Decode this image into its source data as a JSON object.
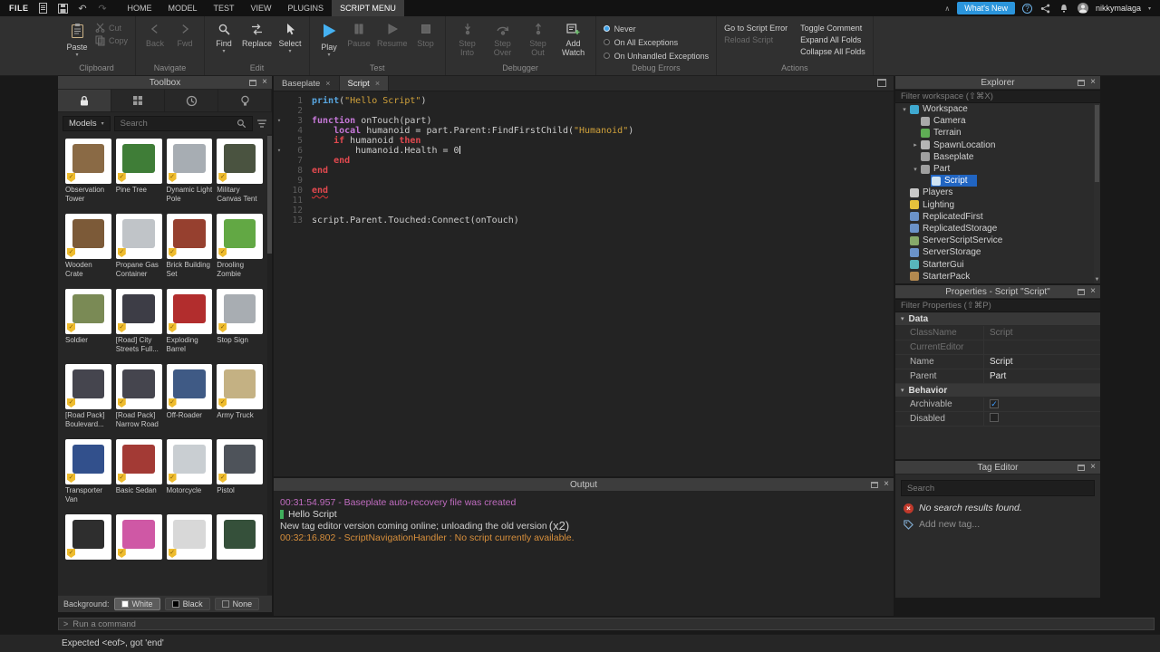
{
  "colors": {
    "selection": "#2165c2",
    "play_button": "#45b1f2",
    "whats_new_button": "#2b95dc",
    "code_keyword": "#c678d8",
    "code_keyword_alt": "#e2494f",
    "code_string": "#d1a23b",
    "code_builtin": "#58a6e0",
    "output_info": "#c06cc0",
    "output_warning": "#d78f3c",
    "output_success_bar": "#3fae5c",
    "verified_badge": "#eebc2e"
  },
  "titlebar": {
    "file_label": "FILE",
    "menu_tabs": [
      "HOME",
      "MODEL",
      "TEST",
      "VIEW",
      "PLUGINS",
      "SCRIPT MENU"
    ],
    "active_tab": "SCRIPT MENU",
    "whats_new": "What's New",
    "username": "nikkymalaga"
  },
  "ribbon": {
    "group_labels": [
      "Clipboard",
      "Navigate",
      "Edit",
      "Test",
      "Debugger",
      "Debug Errors",
      "Actions"
    ],
    "clipboard": {
      "paste": "Paste",
      "cut": "Cut",
      "copy": "Copy"
    },
    "navigate": {
      "back": "Back",
      "fwd": "Fwd"
    },
    "edit": {
      "find": "Find",
      "replace": "Replace",
      "select": "Select"
    },
    "test": {
      "play": "Play",
      "pause": "Pause",
      "resume": "Resume",
      "stop": "Stop"
    },
    "debugger": {
      "step_into": "Step Into",
      "step_over": "Step Over",
      "step_out": "Step Out",
      "add_watch": "Add Watch"
    },
    "debug_errors": {
      "options": [
        "Never",
        "On All Exceptions",
        "On Unhandled Exceptions"
      ],
      "selected": "Never"
    },
    "actions": {
      "column1": [
        {
          "label": "Go to Script Error",
          "disabled": false
        },
        {
          "label": "Reload Script",
          "disabled": true
        }
      ],
      "column2": [
        {
          "label": "Toggle Comment",
          "disabled": false
        },
        {
          "label": "Expand All Folds",
          "disabled": false
        },
        {
          "label": "Collapse All Folds",
          "disabled": false
        }
      ]
    }
  },
  "toolbox": {
    "title": "Toolbox",
    "category": "Models",
    "search_placeholder": "Search",
    "items": [
      {
        "label": "Observation Tower",
        "color": "#8a6a45",
        "badge": true
      },
      {
        "label": "Pine Tree",
        "color": "#3f7d37",
        "badge": true
      },
      {
        "label": "Dynamic Light Pole",
        "color": "#a7adb3",
        "badge": true
      },
      {
        "label": "Military Canvas Tent",
        "color": "#4a5340",
        "badge": true
      },
      {
        "label": "Wooden Crate",
        "color": "#7c5a38",
        "badge": true
      },
      {
        "label": "Propane Gas Container",
        "color": "#c0c4c8",
        "badge": true
      },
      {
        "label": "Brick Building Set",
        "color": "#96402f",
        "badge": true
      },
      {
        "label": "Drooling Zombie",
        "color": "#62a844",
        "badge": true
      },
      {
        "label": "Soldier",
        "color": "#7a8a55",
        "badge": true
      },
      {
        "label": "[Road] City Streets Full...",
        "color": "#3d3d46",
        "badge": true
      },
      {
        "label": "Exploding Barrel",
        "color": "#b22d2d",
        "badge": true
      },
      {
        "label": "Stop Sign",
        "color": "#a8adb2",
        "badge": true
      },
      {
        "label": "[Road Pack] Boulevard...",
        "color": "#45454e",
        "badge": true
      },
      {
        "label": "[Road Pack] Narrow Road",
        "color": "#45454e",
        "badge": true
      },
      {
        "label": "Off-Roader",
        "color": "#3f5a85",
        "badge": true
      },
      {
        "label": "Army Truck",
        "color": "#c4b183",
        "badge": true
      },
      {
        "label": "Transporter Van",
        "color": "#32508c",
        "badge": true
      },
      {
        "label": "Basic Sedan",
        "color": "#a33a35",
        "badge": true
      },
      {
        "label": "Motorcycle",
        "color": "#c9ced2",
        "badge": true
      },
      {
        "label": "Pistol",
        "color": "#4e535a",
        "badge": true
      },
      {
        "label": "",
        "color": "#2e2e2e",
        "badge": true
      },
      {
        "label": "",
        "color": "#cf58a5",
        "badge": true
      },
      {
        "label": "",
        "color": "#d8d8d8",
        "badge": true
      },
      {
        "label": "",
        "color": "#35503a",
        "badge": false
      }
    ],
    "background": {
      "label": "Background:",
      "options": [
        "White",
        "Black",
        "None"
      ],
      "selected": "White"
    }
  },
  "editor": {
    "tabs": [
      {
        "label": "Baseplate"
      },
      {
        "label": "Script"
      }
    ],
    "active_tab": "Script",
    "lines": [
      {
        "n": 1,
        "seg": [
          {
            "t": "print",
            "c": "fn"
          },
          {
            "t": "(",
            "c": "pln"
          },
          {
            "t": "\"Hello Script\"",
            "c": "str"
          },
          {
            "t": ")",
            "c": "pln"
          }
        ]
      },
      {
        "n": 2,
        "seg": []
      },
      {
        "n": 3,
        "fold": true,
        "seg": [
          {
            "t": "function",
            "c": "kw"
          },
          {
            "t": " onTouch(part)",
            "c": "pln"
          }
        ]
      },
      {
        "n": 4,
        "seg": [
          {
            "t": "    ",
            "c": "pln"
          },
          {
            "t": "local",
            "c": "kw"
          },
          {
            "t": " humanoid = part.Parent:FindFirstChild(",
            "c": "pln"
          },
          {
            "t": "\"Humanoid\"",
            "c": "str"
          },
          {
            "t": ")",
            "c": "pln"
          }
        ]
      },
      {
        "n": 5,
        "seg": [
          {
            "t": "    ",
            "c": "pln"
          },
          {
            "t": "if",
            "c": "kw2"
          },
          {
            "t": " humanoid ",
            "c": "pln"
          },
          {
            "t": "then",
            "c": "kw2"
          }
        ]
      },
      {
        "n": 6,
        "fold": true,
        "caret": true,
        "seg": [
          {
            "t": "        humanoid.Health = 0",
            "c": "pln"
          }
        ]
      },
      {
        "n": 7,
        "seg": [
          {
            "t": "    ",
            "c": "pln"
          },
          {
            "t": "end",
            "c": "kw2"
          }
        ]
      },
      {
        "n": 8,
        "seg": [
          {
            "t": "end",
            "c": "kw2"
          }
        ]
      },
      {
        "n": 9,
        "seg": []
      },
      {
        "n": 10,
        "seg": [
          {
            "t": "end",
            "c": "err"
          }
        ]
      },
      {
        "n": 11,
        "seg": []
      },
      {
        "n": 12,
        "seg": []
      },
      {
        "n": 13,
        "seg": [
          {
            "t": "script.Parent.Touched:Connect(onTouch)",
            "c": "pln"
          }
        ]
      }
    ]
  },
  "output": {
    "title": "Output",
    "lines": [
      {
        "text": "00:31:54.957 - Baseplate auto-recovery file was created",
        "color": "#c06cc0"
      },
      {
        "text": "Hello Script",
        "color": "#d8d8d8",
        "bar": "#3fae5c"
      },
      {
        "text": "New tag editor version coming online; unloading the old version ",
        "color": "#cfcfcf",
        "suffix": "(x2)"
      },
      {
        "text": "00:32:16.802 - ScriptNavigationHandler : No script currently available.",
        "color": "#d78f3c"
      }
    ]
  },
  "explorer": {
    "title": "Explorer",
    "filter_placeholder": "Filter workspace (⇧⌘X)",
    "items": [
      {
        "label": "Workspace",
        "indent": 0,
        "arrow": "down",
        "color": "#3fa9d0"
      },
      {
        "label": "Camera",
        "indent": 1,
        "arrow": null,
        "color": "#a9a9a9"
      },
      {
        "label": "Terrain",
        "indent": 1,
        "arrow": null,
        "color": "#5fae55"
      },
      {
        "label": "SpawnLocation",
        "indent": 1,
        "arrow": "right",
        "color": "#b5b5b5"
      },
      {
        "label": "Baseplate",
        "indent": 1,
        "arrow": null,
        "color": "#9f9f9f"
      },
      {
        "label": "Part",
        "indent": 1,
        "arrow": "down",
        "color": "#9f9f9f"
      },
      {
        "label": "Script",
        "indent": 2,
        "arrow": null,
        "color": "#cfe3f2",
        "selected": true
      },
      {
        "label": "Players",
        "indent": 0,
        "arrow": null,
        "color": "#c9c9c9"
      },
      {
        "label": "Lighting",
        "indent": 0,
        "arrow": null,
        "color": "#e5c23c"
      },
      {
        "label": "ReplicatedFirst",
        "indent": 0,
        "arrow": null,
        "color": "#6b93c9"
      },
      {
        "label": "ReplicatedStorage",
        "indent": 0,
        "arrow": null,
        "color": "#6b93c9"
      },
      {
        "label": "ServerScriptService",
        "indent": 0,
        "arrow": null,
        "color": "#86a96a"
      },
      {
        "label": "ServerStorage",
        "indent": 0,
        "arrow": null,
        "color": "#6b93c9"
      },
      {
        "label": "StarterGui",
        "indent": 0,
        "arrow": null,
        "color": "#58b5ba"
      },
      {
        "label": "StarterPack",
        "indent": 0,
        "arrow": null,
        "color": "#b3894f"
      }
    ]
  },
  "properties": {
    "title": "Properties - Script \"Script\"",
    "filter_placeholder": "Filter Properties (⇧⌘P)",
    "sections": [
      {
        "title": "Data",
        "rows": [
          {
            "label": "ClassName",
            "value": "Script",
            "muted": true
          },
          {
            "label": "CurrentEditor",
            "value": "",
            "muted": true
          },
          {
            "label": "Name",
            "value": "Script",
            "muted": false
          },
          {
            "label": "Parent",
            "value": "Part",
            "muted": false
          }
        ]
      },
      {
        "title": "Behavior",
        "rows": [
          {
            "label": "Archivable",
            "type": "checkbox",
            "checked": true
          },
          {
            "label": "Disabled",
            "type": "checkbox",
            "checked": false
          }
        ]
      }
    ]
  },
  "tag_editor": {
    "title": "Tag Editor",
    "search_placeholder": "Search",
    "no_results": "No search results found.",
    "add_tag": "Add new tag..."
  },
  "command_bar": {
    "placeholder": "Run a command"
  },
  "status_bar": {
    "message": "Expected <eof>, got 'end'"
  }
}
